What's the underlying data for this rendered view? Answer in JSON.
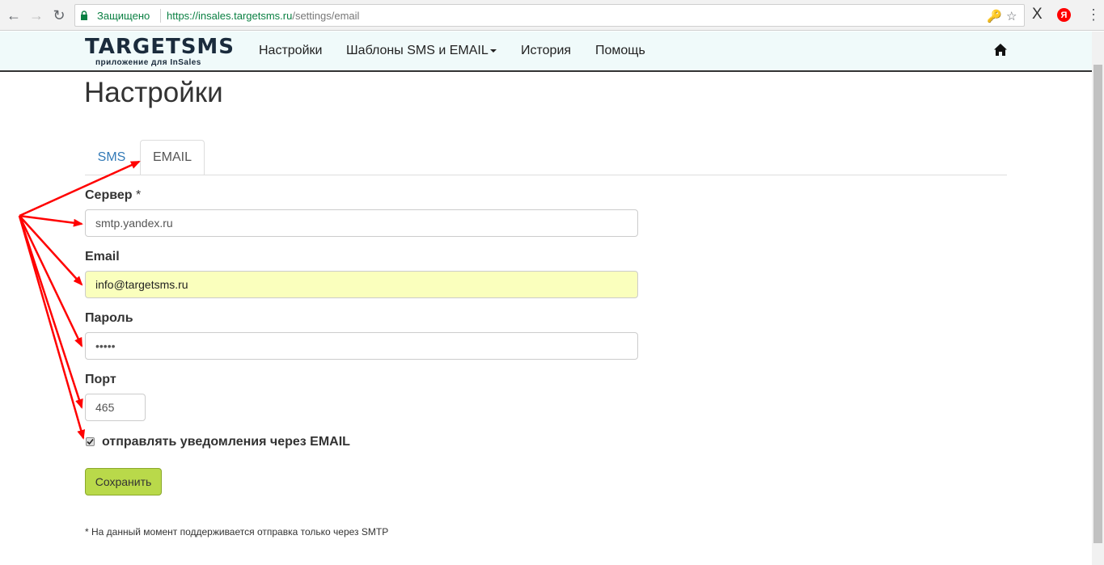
{
  "browser": {
    "secure_label": "Защищено",
    "url_host": "https://insales.targetsms.ru",
    "url_path": "/settings/email",
    "ext_x": "X",
    "ext_ya": "Я"
  },
  "navbar": {
    "logo_main": "TARGETSMS",
    "logo_sub": "приложение для InSales",
    "items": [
      {
        "label": "Настройки"
      },
      {
        "label": "Шаблоны SMS и EMAIL"
      },
      {
        "label": "История"
      },
      {
        "label": "Помощь"
      }
    ]
  },
  "page": {
    "title": "Настройки",
    "tabs": [
      {
        "label": "SMS",
        "active": false
      },
      {
        "label": "EMAIL",
        "active": true
      }
    ]
  },
  "form": {
    "server": {
      "label": "Сервер",
      "required_mark": "*",
      "value": "smtp.yandex.ru"
    },
    "email": {
      "label": "Email",
      "value": "info@targetsms.ru"
    },
    "password": {
      "label": "Пароль",
      "value": "•••••"
    },
    "port": {
      "label": "Порт",
      "value": "465"
    },
    "notify": {
      "label": "отправлять уведомления через EMAIL",
      "checked": true
    },
    "save_label": "Сохранить",
    "note": "* На данный момент поддерживается отправка только через SMTP"
  },
  "colors": {
    "accent": "#337ab7",
    "save_button": "#b9d94a",
    "autofill": "#faffbd",
    "annotation_arrow": "#ff0000"
  }
}
